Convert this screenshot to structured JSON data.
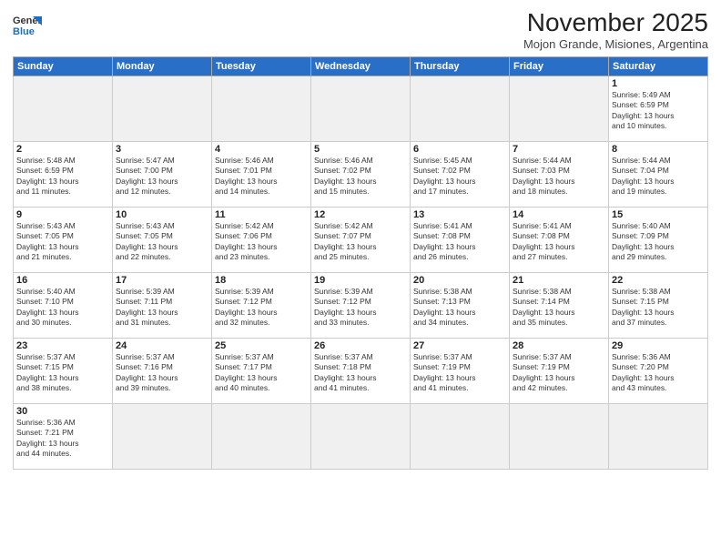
{
  "logo": {
    "line1": "General",
    "line2": "Blue"
  },
  "title": "November 2025",
  "subtitle": "Mojon Grande, Misiones, Argentina",
  "weekdays": [
    "Sunday",
    "Monday",
    "Tuesday",
    "Wednesday",
    "Thursday",
    "Friday",
    "Saturday"
  ],
  "weeks": [
    [
      {
        "day": "",
        "info": ""
      },
      {
        "day": "",
        "info": ""
      },
      {
        "day": "",
        "info": ""
      },
      {
        "day": "",
        "info": ""
      },
      {
        "day": "",
        "info": ""
      },
      {
        "day": "",
        "info": ""
      },
      {
        "day": "1",
        "info": "Sunrise: 5:49 AM\nSunset: 6:59 PM\nDaylight: 13 hours\nand 10 minutes."
      }
    ],
    [
      {
        "day": "2",
        "info": "Sunrise: 5:48 AM\nSunset: 6:59 PM\nDaylight: 13 hours\nand 11 minutes."
      },
      {
        "day": "3",
        "info": "Sunrise: 5:47 AM\nSunset: 7:00 PM\nDaylight: 13 hours\nand 12 minutes."
      },
      {
        "day": "4",
        "info": "Sunrise: 5:46 AM\nSunset: 7:01 PM\nDaylight: 13 hours\nand 14 minutes."
      },
      {
        "day": "5",
        "info": "Sunrise: 5:46 AM\nSunset: 7:02 PM\nDaylight: 13 hours\nand 15 minutes."
      },
      {
        "day": "6",
        "info": "Sunrise: 5:45 AM\nSunset: 7:02 PM\nDaylight: 13 hours\nand 17 minutes."
      },
      {
        "day": "7",
        "info": "Sunrise: 5:44 AM\nSunset: 7:03 PM\nDaylight: 13 hours\nand 18 minutes."
      },
      {
        "day": "8",
        "info": "Sunrise: 5:44 AM\nSunset: 7:04 PM\nDaylight: 13 hours\nand 19 minutes."
      }
    ],
    [
      {
        "day": "9",
        "info": "Sunrise: 5:43 AM\nSunset: 7:05 PM\nDaylight: 13 hours\nand 21 minutes."
      },
      {
        "day": "10",
        "info": "Sunrise: 5:43 AM\nSunset: 7:05 PM\nDaylight: 13 hours\nand 22 minutes."
      },
      {
        "day": "11",
        "info": "Sunrise: 5:42 AM\nSunset: 7:06 PM\nDaylight: 13 hours\nand 23 minutes."
      },
      {
        "day": "12",
        "info": "Sunrise: 5:42 AM\nSunset: 7:07 PM\nDaylight: 13 hours\nand 25 minutes."
      },
      {
        "day": "13",
        "info": "Sunrise: 5:41 AM\nSunset: 7:08 PM\nDaylight: 13 hours\nand 26 minutes."
      },
      {
        "day": "14",
        "info": "Sunrise: 5:41 AM\nSunset: 7:08 PM\nDaylight: 13 hours\nand 27 minutes."
      },
      {
        "day": "15",
        "info": "Sunrise: 5:40 AM\nSunset: 7:09 PM\nDaylight: 13 hours\nand 29 minutes."
      }
    ],
    [
      {
        "day": "16",
        "info": "Sunrise: 5:40 AM\nSunset: 7:10 PM\nDaylight: 13 hours\nand 30 minutes."
      },
      {
        "day": "17",
        "info": "Sunrise: 5:39 AM\nSunset: 7:11 PM\nDaylight: 13 hours\nand 31 minutes."
      },
      {
        "day": "18",
        "info": "Sunrise: 5:39 AM\nSunset: 7:12 PM\nDaylight: 13 hours\nand 32 minutes."
      },
      {
        "day": "19",
        "info": "Sunrise: 5:39 AM\nSunset: 7:12 PM\nDaylight: 13 hours\nand 33 minutes."
      },
      {
        "day": "20",
        "info": "Sunrise: 5:38 AM\nSunset: 7:13 PM\nDaylight: 13 hours\nand 34 minutes."
      },
      {
        "day": "21",
        "info": "Sunrise: 5:38 AM\nSunset: 7:14 PM\nDaylight: 13 hours\nand 35 minutes."
      },
      {
        "day": "22",
        "info": "Sunrise: 5:38 AM\nSunset: 7:15 PM\nDaylight: 13 hours\nand 37 minutes."
      }
    ],
    [
      {
        "day": "23",
        "info": "Sunrise: 5:37 AM\nSunset: 7:15 PM\nDaylight: 13 hours\nand 38 minutes."
      },
      {
        "day": "24",
        "info": "Sunrise: 5:37 AM\nSunset: 7:16 PM\nDaylight: 13 hours\nand 39 minutes."
      },
      {
        "day": "25",
        "info": "Sunrise: 5:37 AM\nSunset: 7:17 PM\nDaylight: 13 hours\nand 40 minutes."
      },
      {
        "day": "26",
        "info": "Sunrise: 5:37 AM\nSunset: 7:18 PM\nDaylight: 13 hours\nand 41 minutes."
      },
      {
        "day": "27",
        "info": "Sunrise: 5:37 AM\nSunset: 7:19 PM\nDaylight: 13 hours\nand 41 minutes."
      },
      {
        "day": "28",
        "info": "Sunrise: 5:37 AM\nSunset: 7:19 PM\nDaylight: 13 hours\nand 42 minutes."
      },
      {
        "day": "29",
        "info": "Sunrise: 5:36 AM\nSunset: 7:20 PM\nDaylight: 13 hours\nand 43 minutes."
      }
    ],
    [
      {
        "day": "30",
        "info": "Sunrise: 5:36 AM\nSunset: 7:21 PM\nDaylight: 13 hours\nand 44 minutes."
      },
      {
        "day": "",
        "info": ""
      },
      {
        "day": "",
        "info": ""
      },
      {
        "day": "",
        "info": ""
      },
      {
        "day": "",
        "info": ""
      },
      {
        "day": "",
        "info": ""
      },
      {
        "day": "",
        "info": ""
      }
    ]
  ]
}
